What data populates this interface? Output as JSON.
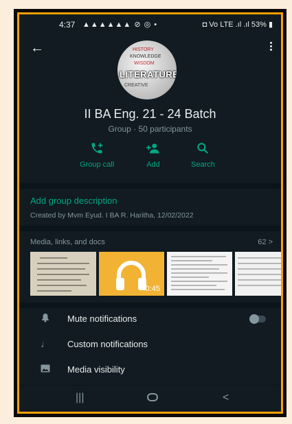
{
  "status_bar": {
    "time": "4:37",
    "left_icons": "▲▲▲▲▲▲ ⊘ ◎ •",
    "right_icons": "◘ Vo LTE .ıl .ıl",
    "battery": "53%"
  },
  "header": {
    "back_icon": "arrow-left-icon",
    "menu_icon": "overflow-menu-icon",
    "avatar": {
      "words": [
        "HISTORY",
        "KNOWLEDGE",
        "WISDOM",
        "LITERATURE",
        "CREATIVE"
      ]
    }
  },
  "group": {
    "name": "II BA Eng. 21 - 24 Batch",
    "subtitle": "Group · 50 participants"
  },
  "actions": [
    {
      "label": "Group call",
      "icon": "add-call-icon"
    },
    {
      "label": "Add",
      "icon": "add-person-icon"
    },
    {
      "label": "Search",
      "icon": "search-icon"
    }
  ],
  "description": {
    "add_label": "Add group description",
    "created_by": "Created by Mvm Eyud. I BA R. Haritha, 12/02/2022"
  },
  "media": {
    "header": "Media, links, and docs",
    "count": "62 >",
    "audio_duration": "0:45"
  },
  "settings": [
    {
      "label": "Mute notifications",
      "icon": "bell-icon",
      "toggle": false
    },
    {
      "label": "Custom notifications",
      "icon": "music-note-icon"
    },
    {
      "label": "Media visibility",
      "icon": "image-icon"
    }
  ],
  "colors": {
    "accent": "#00a884",
    "background": "#111b21",
    "border": "#ffa000"
  }
}
